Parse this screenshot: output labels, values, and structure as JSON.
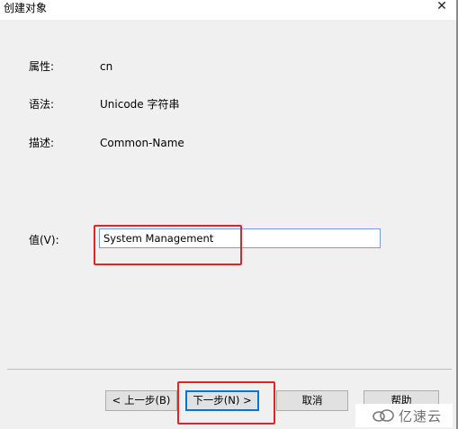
{
  "window": {
    "title": "创建对象"
  },
  "fields": {
    "attribute_label": "属性:",
    "attribute_value": "cn",
    "syntax_label": "语法:",
    "syntax_value": "Unicode 字符串",
    "description_label": "描述:",
    "description_value": "Common-Name",
    "value_label": "值(V):",
    "value_input": "System Management"
  },
  "buttons": {
    "back": "< 上一步(B)",
    "next": "下一步(N) >",
    "cancel": "取消",
    "help": "帮助"
  },
  "watermark": {
    "text": "亿速云"
  },
  "colors": {
    "highlight": "#e0242a",
    "focus": "#0078d7"
  }
}
